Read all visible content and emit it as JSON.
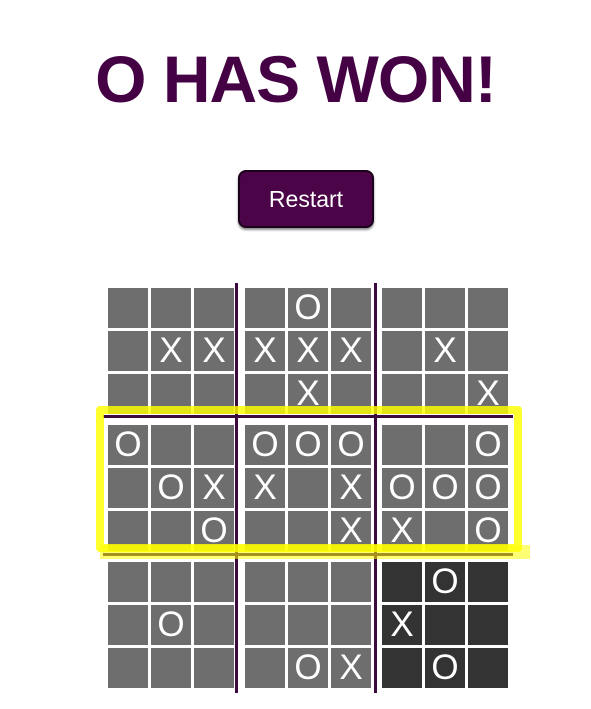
{
  "title": "O HAS WON!",
  "restart_label": "Restart",
  "winner": "O",
  "winning_row": 1,
  "colors": {
    "title": "#440144",
    "button_bg": "#4a0447",
    "cell": "#6e6e6e",
    "active_cell": "#333333",
    "divider": "#3c0a3c",
    "highlight": "#ffff00"
  },
  "board": [
    [
      {
        "cells": [
          "",
          "",
          "",
          "",
          "X",
          "X",
          "",
          "",
          ""
        ],
        "active": false
      },
      {
        "cells": [
          "",
          "O",
          "",
          "X",
          "X",
          "X",
          "",
          "X",
          ""
        ],
        "active": false
      },
      {
        "cells": [
          "",
          "",
          "",
          "",
          "X",
          "",
          "",
          "",
          "X"
        ],
        "active": false
      }
    ],
    [
      {
        "cells": [
          "O",
          "",
          "",
          "",
          "O",
          "X",
          "",
          "",
          "O"
        ],
        "active": false
      },
      {
        "cells": [
          "O",
          "O",
          "O",
          "X",
          "",
          "X",
          "",
          "",
          "X"
        ],
        "active": false
      },
      {
        "cells": [
          "",
          "",
          "O",
          "O",
          "O",
          "O",
          "X",
          "",
          "O"
        ],
        "active": false
      }
    ],
    [
      {
        "cells": [
          "",
          "",
          "",
          "",
          "O",
          "",
          "",
          "",
          ""
        ],
        "active": false
      },
      {
        "cells": [
          "",
          "",
          "",
          "",
          "",
          "",
          "",
          "O",
          "X"
        ],
        "active": false
      },
      {
        "cells": [
          "",
          "O",
          "",
          "X",
          "",
          "",
          "",
          "O",
          ""
        ],
        "active": true
      }
    ]
  ]
}
